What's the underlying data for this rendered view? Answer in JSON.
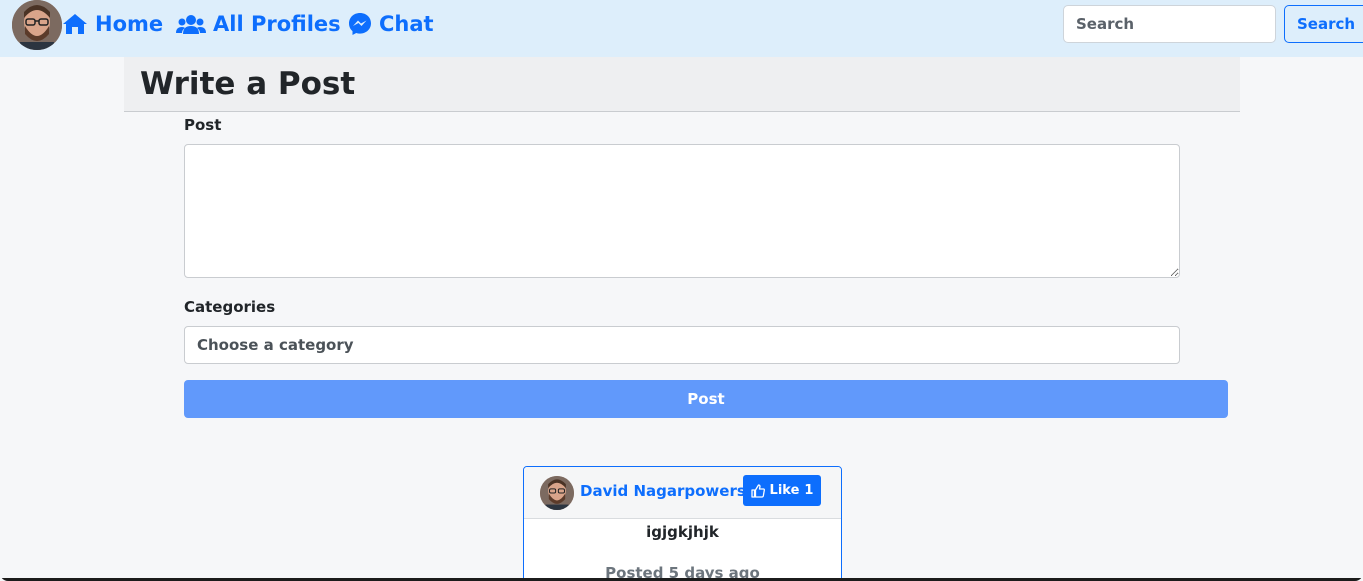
{
  "nav": {
    "items": [
      {
        "label": "Home",
        "icon": "home-icon"
      },
      {
        "label": "All Profiles",
        "icon": "users-icon"
      },
      {
        "label": "Chat",
        "icon": "messenger-icon"
      }
    ],
    "search": {
      "placeholder": "Search",
      "button_label": "Search"
    }
  },
  "page": {
    "title": "Write a Post"
  },
  "form": {
    "post_label": "Post",
    "post_value": "",
    "categories_label": "Categories",
    "category_placeholder": "Choose a category",
    "submit_label": "Post"
  },
  "feed": {
    "posts": [
      {
        "author": "David Nagarpowers",
        "like_label": "Like",
        "like_count": "1",
        "body": "igjgkjhjk",
        "posted": "Posted 5 days ago"
      }
    ]
  },
  "colors": {
    "navbar_bg": "#ddeefb",
    "primary": "#0d6efd",
    "post_button": "#6199fb",
    "page_bg": "#f6f7f9"
  }
}
